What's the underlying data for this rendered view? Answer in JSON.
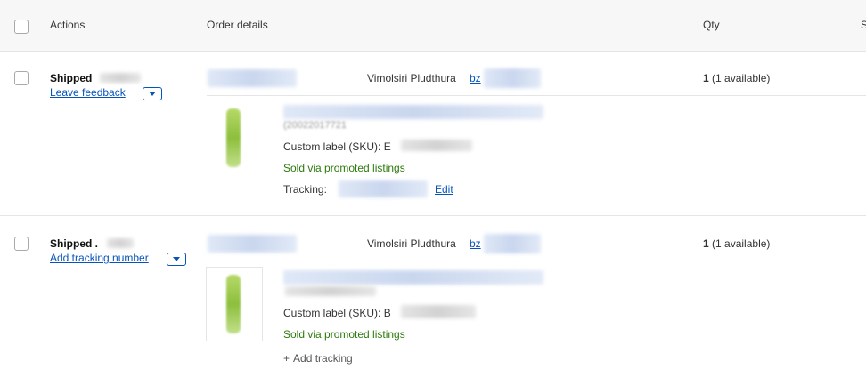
{
  "header": {
    "actions": "Actions",
    "order_details": "Order details",
    "qty": "Qty",
    "clipped": "S"
  },
  "orders": [
    {
      "status": "Shipped",
      "action_link": "Leave feedback",
      "buyer_name": "Vimolsiri Pludthura",
      "buyer_link_prefix": "bz",
      "qty_number": "1",
      "qty_available": "(1 available)",
      "item_id_fragment": "(20022017721",
      "sku_label": "Custom label (SKU):",
      "sku_prefix": "E",
      "promoted": "Sold via promoted listings",
      "tracking_label": "Tracking:",
      "edit_link": "Edit"
    },
    {
      "status": "Shipped .",
      "action_link": "Add tracking number",
      "buyer_name": "Vimolsiri Pludthura",
      "buyer_link_prefix": "bz",
      "qty_number": "1",
      "qty_available": "(1 available)",
      "sku_label": "Custom label (SKU):",
      "sku_prefix": "B",
      "promoted": "Sold via promoted listings",
      "add_tracking": "Add tracking"
    }
  ],
  "colors": {
    "link": "#0654ba",
    "promoted": "#2b7a0b",
    "header_bg": "#f7f7f7"
  }
}
